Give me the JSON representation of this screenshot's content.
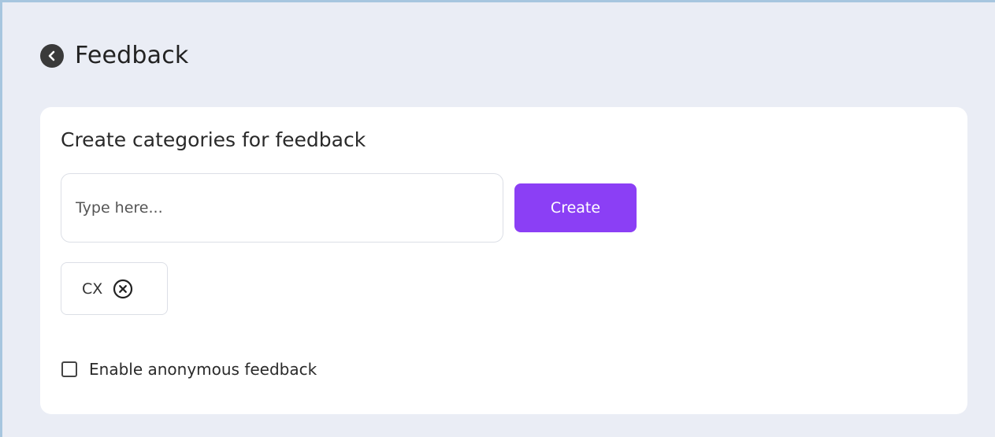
{
  "header": {
    "title": "Feedback",
    "back_icon": "chevron-left-circle-icon"
  },
  "card": {
    "title": "Create categories for feedback",
    "input": {
      "placeholder": "Type here...",
      "value": ""
    },
    "create_button": "Create",
    "categories": [
      {
        "label": "CX",
        "remove_icon": "close-circle-icon"
      }
    ],
    "anonymous": {
      "label": "Enable anonymous feedback",
      "checked": false
    }
  },
  "colors": {
    "background": "#eaedf5",
    "accent": "#8b3ff5",
    "card": "#ffffff",
    "border": "#dcdfe6"
  }
}
